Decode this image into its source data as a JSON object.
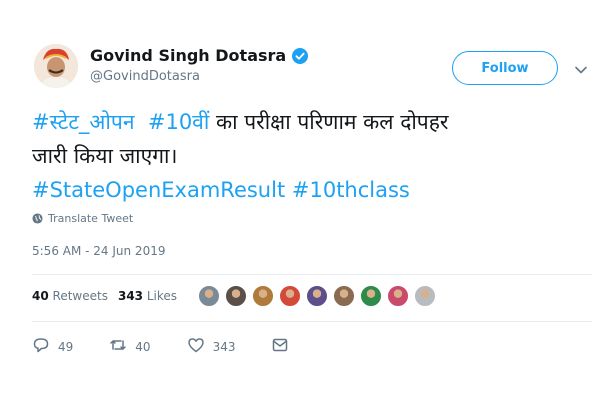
{
  "author": {
    "name": "Govind Singh Dotasra",
    "handle": "@GovindDotasra",
    "follow_label": "Follow"
  },
  "tweet": {
    "hashtag_state_open": "#स्टेट_ओपन",
    "hashtag_10th_hindi": "#10वीं",
    "text_line1_rest": "का परीक्षा परिणाम कल दोपहर",
    "text_line2": "जारी किया जाएगा।",
    "hashtag_result": "#StateOpenExamResult",
    "hashtag_10thclass": "#10thclass"
  },
  "translate_label": "Translate Tweet",
  "timestamp": "5:56 AM - 24 Jun 2019",
  "stats": {
    "retweets_count": "40",
    "retweets_label": "Retweets",
    "likes_count": "343",
    "likes_label": "Likes"
  },
  "likers_colors": [
    "#7a8a96",
    "#5a5048",
    "#b07a3a",
    "#d44a3a",
    "#5c4f8a",
    "#8a6a50",
    "#2e8b4a",
    "#c94a6a",
    "#b8bcc0"
  ],
  "actions": {
    "reply_count": "49",
    "retweet_count": "40",
    "like_count": "343"
  },
  "colors": {
    "accent": "#1da1f2",
    "text_primary": "#14171a",
    "text_secondary": "#657786"
  },
  "icons": [
    "verified-badge-icon",
    "chevron-down-icon",
    "globe-icon",
    "reply-icon",
    "retweet-icon",
    "heart-icon",
    "direct-message-icon"
  ]
}
